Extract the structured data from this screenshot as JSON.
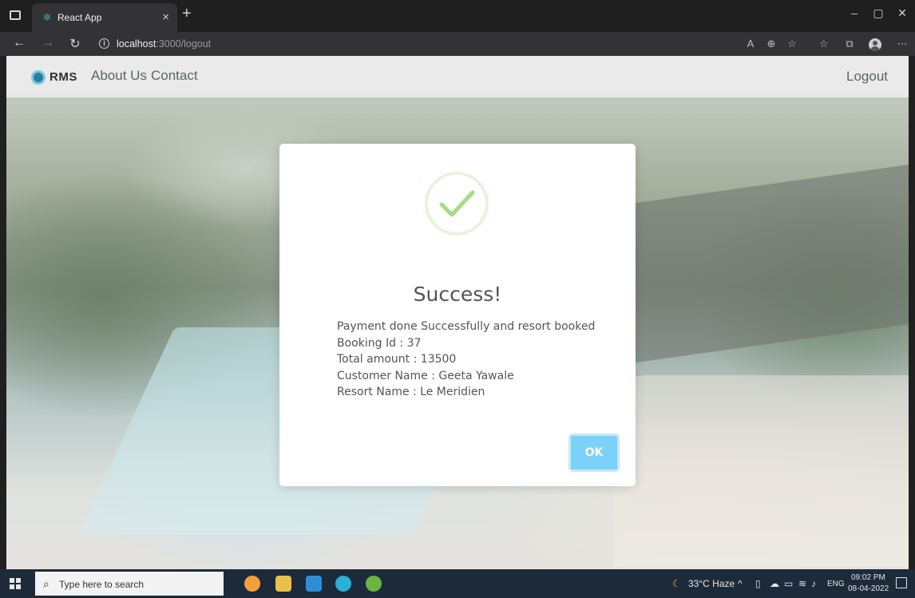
{
  "browser": {
    "tab_title": "React App",
    "tab_close": "×",
    "new_tab": "+",
    "url_host": "localhost",
    "url_path": ":3000/logout",
    "window_buttons": {
      "minimize": "–",
      "maximize": "▢",
      "close": "✕"
    }
  },
  "navbar": {
    "brand": "RMS",
    "links": [
      "About Us",
      "Contact"
    ],
    "logout": "Logout"
  },
  "modal": {
    "title": "Success!",
    "lines": [
      "Payment done Successfully and resort booked",
      "Booking Id : 37",
      "Total amount : 13500",
      "Customer Name : Geeta Yawale",
      "Resort Name : Le Meridien"
    ],
    "ok_label": "OK",
    "icon": "success-check-icon",
    "accent": "#a5dc86",
    "button_color": "#7cd1f9"
  },
  "taskbar": {
    "search_placeholder": "Type here to search",
    "weather": "33°C Haze",
    "language": "ENG",
    "time": "09:02 PM",
    "date": "08-04-2022"
  }
}
